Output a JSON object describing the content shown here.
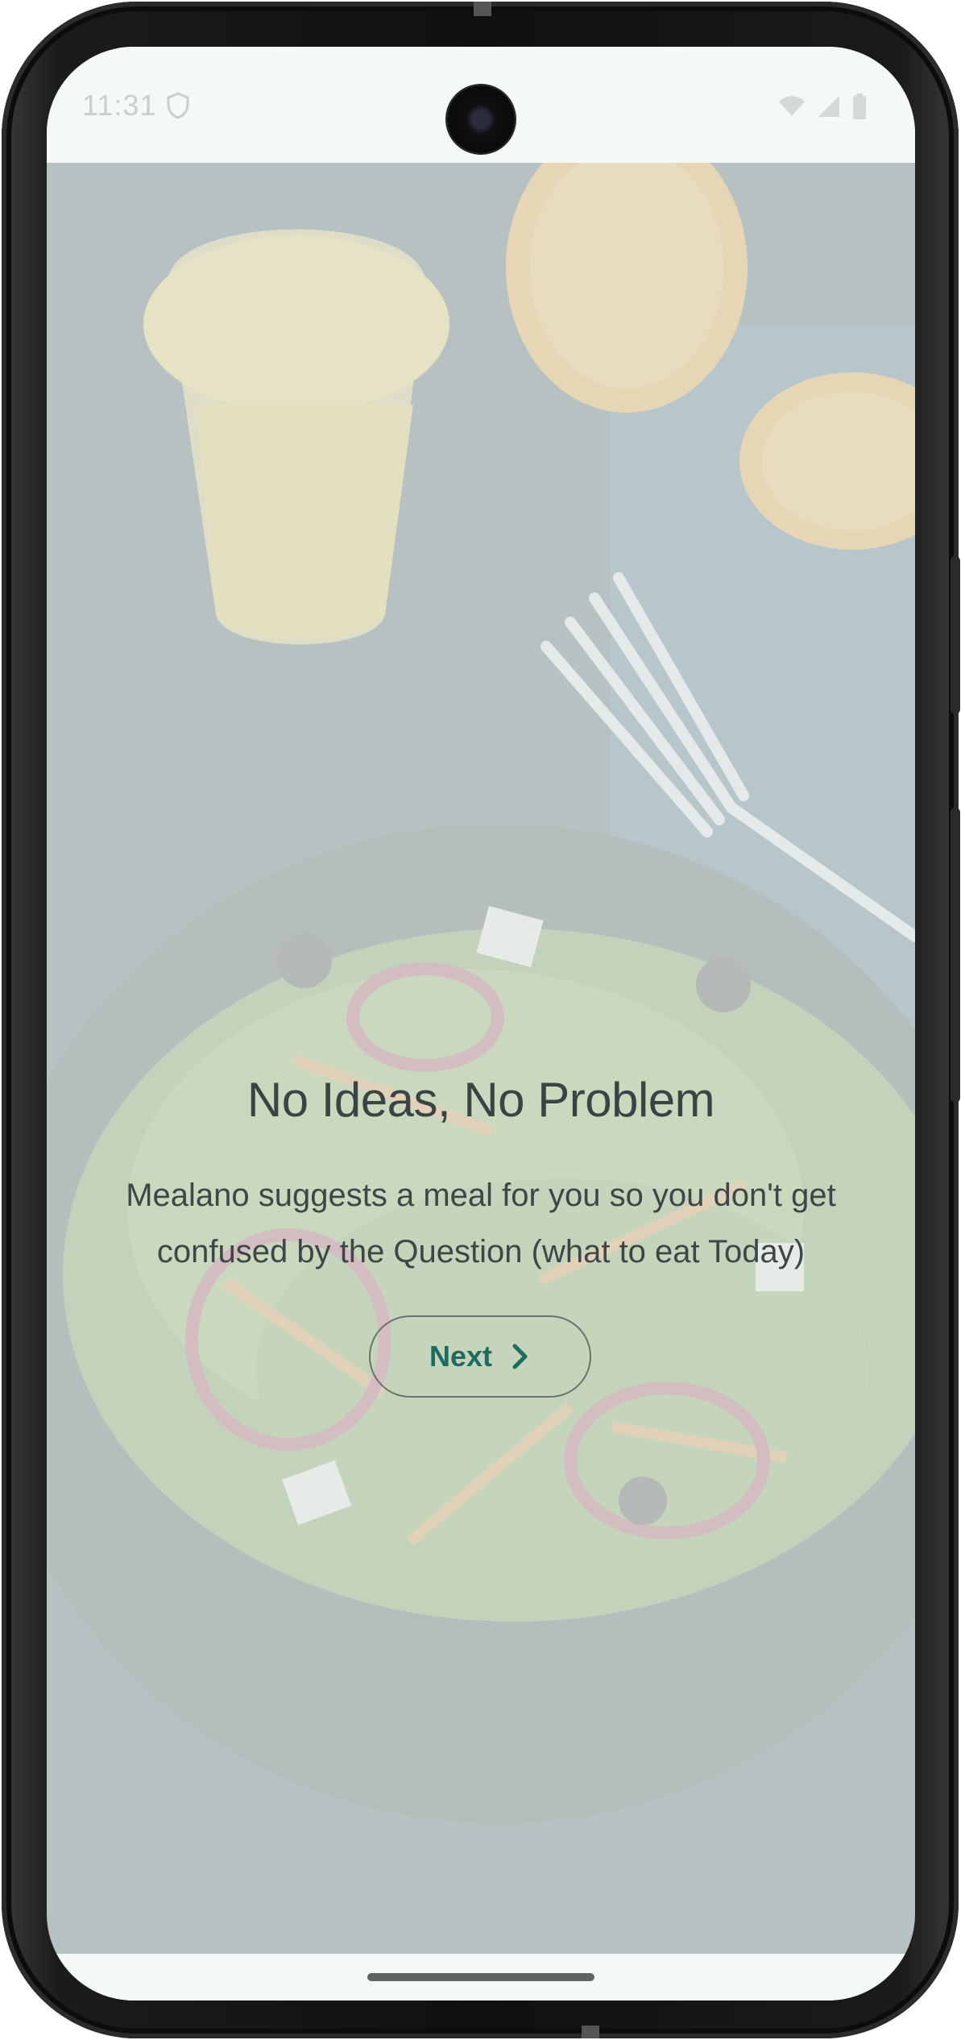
{
  "status_bar": {
    "time": "11:31",
    "icons": [
      "shield-icon",
      "wifi-icon",
      "signal-icon",
      "battery-icon"
    ]
  },
  "onboarding": {
    "title": "No Ideas, No Problem",
    "description": "Mealano suggests a meal for you so you don't get confused by the Question (what to eat Today)",
    "next_label": "Next",
    "next_icon": "chevron-right-icon"
  },
  "background_image": "salad-and-orange-juice-photo",
  "colors": {
    "accent": "#1f6b60",
    "surface": "#f2f9f6",
    "text": "#3c4345"
  }
}
